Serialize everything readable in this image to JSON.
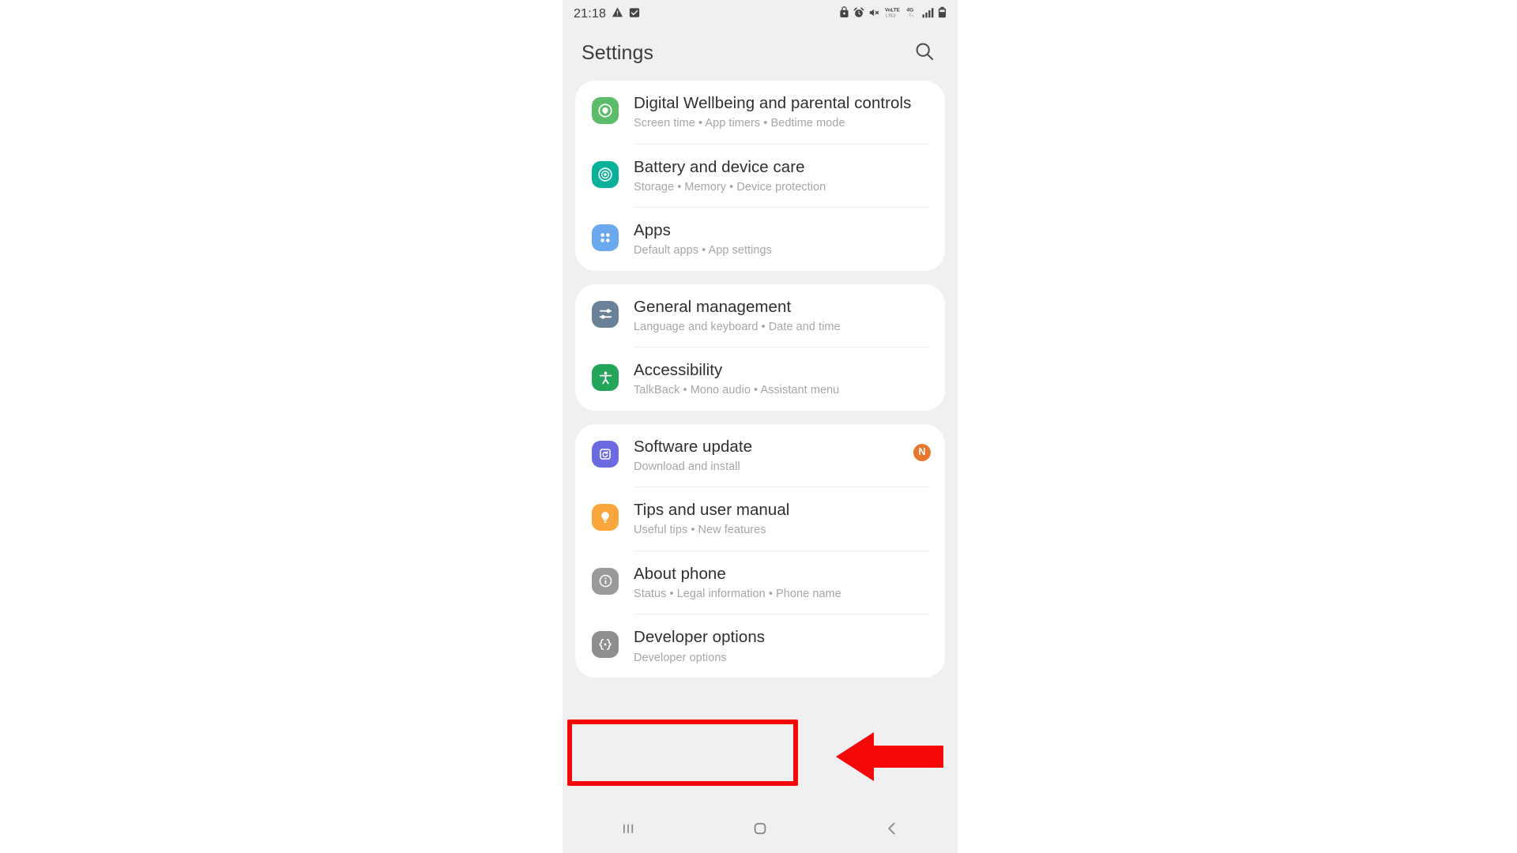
{
  "status_bar": {
    "time": "21:18",
    "left_icons": [
      "warning-triangle-icon",
      "checkbox-checked-icon"
    ],
    "right_icons": [
      "lock-icon",
      "alarm-icon",
      "mute-icon",
      "volte-icon",
      "4g-icon",
      "signal-bars-icon",
      "battery-icon"
    ],
    "volte_label": "VoLTE",
    "network_label": "4G"
  },
  "app_bar": {
    "title": "Settings",
    "search_icon": "search-icon"
  },
  "cards": [
    {
      "rows": [
        {
          "title": "Digital Wellbeing and parental controls",
          "subtitle": "Screen time  •  App timers  •  Bedtime mode",
          "icon": "digital-wellbeing-icon",
          "icon_color": "#5bbd6a",
          "badge": null
        },
        {
          "title": "Battery and device care",
          "subtitle": "Storage  •  Memory  •  Device protection",
          "icon": "battery-device-care-icon",
          "icon_color": "#07b098",
          "badge": null
        },
        {
          "title": "Apps",
          "subtitle": "Default apps  •  App settings",
          "icon": "apps-grid-icon",
          "icon_color": "#6aa9ee",
          "badge": null
        }
      ]
    },
    {
      "rows": [
        {
          "title": "General management",
          "subtitle": "Language and keyboard  •  Date and time",
          "icon": "sliders-icon",
          "icon_color": "#6b8198",
          "badge": null
        },
        {
          "title": "Accessibility",
          "subtitle": "TalkBack  •  Mono audio  •  Assistant menu",
          "icon": "accessibility-person-icon",
          "icon_color": "#23a55a",
          "badge": null
        }
      ]
    },
    {
      "rows": [
        {
          "title": "Software update",
          "subtitle": "Download and install",
          "icon": "software-update-icon",
          "icon_color": "#6b6ae0",
          "badge": "N"
        },
        {
          "title": "Tips and user manual",
          "subtitle": "Useful tips  •  New features",
          "icon": "lightbulb-icon",
          "icon_color": "#f9a73c",
          "badge": null
        },
        {
          "title": "About phone",
          "subtitle": "Status  •  Legal information  •  Phone name",
          "icon": "info-circle-icon",
          "icon_color": "#9a9a9a",
          "badge": null
        },
        {
          "title": "Developer options",
          "subtitle": "Developer options",
          "icon": "developer-options-braces-icon",
          "icon_color": "#8e8e8e",
          "badge": null
        }
      ]
    }
  ],
  "nav_bar": {
    "recents_label": "recents-icon",
    "home_label": "home-icon",
    "back_label": "back-icon"
  },
  "annotations": {
    "highlight_color": "#f50808",
    "arrow_color": "#f50808",
    "highlight_target": "Developer options",
    "arrow_direction": "left"
  }
}
